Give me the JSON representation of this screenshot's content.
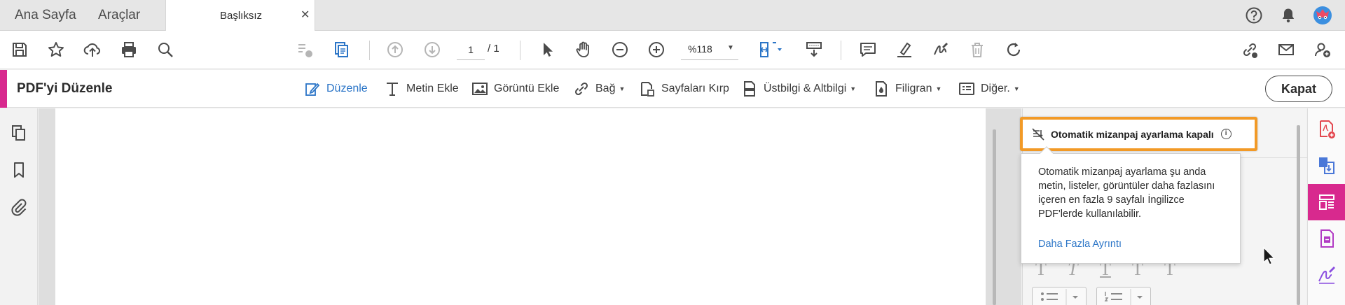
{
  "tabs": {
    "home": "Ana Sayfa",
    "tools": "Araçlar",
    "document": "Başlıksız",
    "close_glyph": "✕"
  },
  "header_icons": [
    "help-icon",
    "bell-icon",
    "user-avatar"
  ],
  "toolbar": {
    "icons": [
      "save-icon",
      "star-icon",
      "upload-icon",
      "print-icon",
      "search-icon",
      "stamp-icon",
      "copy-icon",
      "up-arrow-icon",
      "down-arrow-icon",
      "cursor-icon",
      "hand-icon",
      "zoom-out-icon",
      "zoom-in-icon",
      "fit-icon",
      "scroll-icon",
      "comment-icon",
      "highlight-icon",
      "sign-icon",
      "trash-icon",
      "rotate-icon",
      "share-link-icon",
      "mail-icon",
      "add-user-icon"
    ],
    "page_current": "1",
    "page_total": "/ 1",
    "zoom": "%118"
  },
  "editbar": {
    "title": "PDF'yi Düzenle",
    "tools": {
      "edit": "Düzenle",
      "add_text": "Metin Ekle",
      "add_image": "Görüntü Ekle",
      "link": "Bağ",
      "crop": "Sayfaları Kırp",
      "header_footer": "Üstbilgi & Altbilgi",
      "watermark": "Filigran",
      "more": "Diğer."
    },
    "close": "Kapat"
  },
  "right_panel": {
    "auto_layout_label": "Otomatik mizanpaj ayarlama kapalı",
    "popover_lines": [
      "Otomatik mizanpaj ayarlama şu anda",
      "metin, listeler, görüntüler daha fazlasını",
      "içeren en fazla 9 sayfalı İngilizce",
      "PDF'lerde kullanılabilir."
    ],
    "popover_link": "Daha Fazla Ayrıntı"
  },
  "colors": {
    "accent": "#d8298e",
    "highlight_border": "#f29a27",
    "link": "#2b75c7",
    "active_tool": "#2b75c7"
  }
}
